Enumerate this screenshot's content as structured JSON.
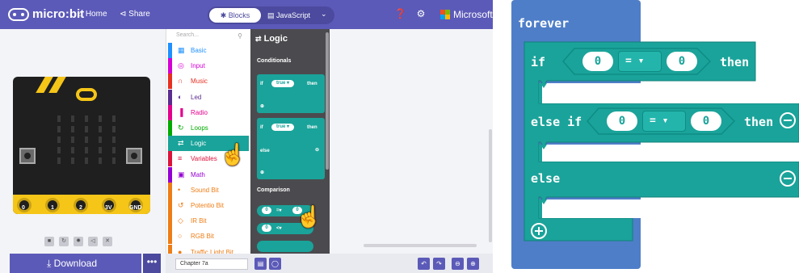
{
  "header": {
    "logo_text": "micro:bit",
    "home_label": "Home",
    "share_label": "Share",
    "blocks_tab": "Blocks",
    "javascript_tab": "JavaScript",
    "microsoft_label": "Microsoft"
  },
  "simulator": {
    "pins": [
      "0",
      "1",
      "2",
      "3V",
      "GND"
    ],
    "download_label": "Download",
    "more_label": "•••"
  },
  "toolbox": {
    "search_placeholder": "Search...",
    "categories": [
      {
        "label": "Basic",
        "icon": "grid-icon",
        "color": "#1e90ff"
      },
      {
        "label": "Input",
        "icon": "target-icon",
        "color": "#d400d4"
      },
      {
        "label": "Music",
        "icon": "headphones-icon",
        "color": "#e63022"
      },
      {
        "label": "Led",
        "icon": "toggle-icon",
        "color": "#5c2d91"
      },
      {
        "label": "Radio",
        "icon": "signal-icon",
        "color": "#e3008c"
      },
      {
        "label": "Loops",
        "icon": "loop-icon",
        "color": "#00aa00"
      },
      {
        "label": "Logic",
        "icon": "shuffle-icon",
        "color": "#1aa39a"
      },
      {
        "label": "Variables",
        "icon": "list-icon",
        "color": "#dc143c"
      },
      {
        "label": "Math",
        "icon": "calculator-icon",
        "color": "#9400d3"
      },
      {
        "label": "Sound Bit",
        "icon": "mic-icon",
        "color": "#ee7d16"
      },
      {
        "label": "Potentio Bit",
        "icon": "refresh-icon",
        "color": "#ee7d16"
      },
      {
        "label": "IR Bit",
        "icon": "sensor-icon",
        "color": "#ee7d16"
      },
      {
        "label": "RGB Bit",
        "icon": "circle-icon",
        "color": "#ee7d16"
      },
      {
        "label": "Traffic Light Bit",
        "icon": "light-icon",
        "color": "#ee7d16"
      }
    ],
    "selected": "Logic"
  },
  "flyout": {
    "title": "Logic",
    "section_conditionals": "Conditionals",
    "section_comparison": "Comparison",
    "mini_if": "if",
    "mini_true": "true ▾",
    "mini_then": "then",
    "mini_else": "else",
    "mini_zero": "0"
  },
  "bottombar": {
    "project_name": "Chapter 7a"
  },
  "blocks": {
    "forever": "forever",
    "if": "if",
    "then": "then",
    "else_if": "else if",
    "else": "else",
    "left_value": "0",
    "operator": "= ▾",
    "right_value": "0"
  },
  "colors": {
    "header": "#5c5ab8",
    "logic_teal": "#1aa39a",
    "loop_blue": "#4e7ec8",
    "flyout_bg": "#4b4b4f"
  }
}
